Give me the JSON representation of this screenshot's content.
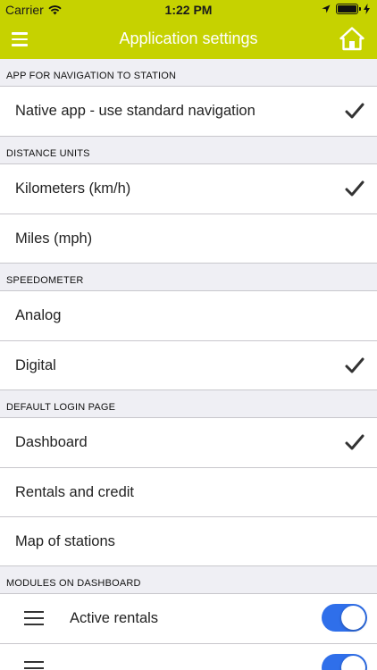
{
  "status_bar": {
    "carrier": "Carrier",
    "time": "1:22 PM",
    "battery_level": 1.0
  },
  "nav": {
    "title": "Application settings",
    "menu_icon": "hamburger-icon",
    "home_icon": "home-icon"
  },
  "colors": {
    "accent": "#c6d200",
    "toggle_on": "#2f6fea",
    "background": "#efeff4"
  },
  "sections": {
    "navigation": {
      "header": "APP FOR NAVIGATION TO STATION",
      "items": [
        {
          "label": "Native app - use standard navigation",
          "checked": true
        }
      ]
    },
    "distance": {
      "header": "DISTANCE UNITS",
      "items": [
        {
          "label": "Kilometers (km/h)",
          "checked": true
        },
        {
          "label": "Miles (mph)",
          "checked": false
        }
      ]
    },
    "speedometer": {
      "header": "SPEEDOMETER",
      "items": [
        {
          "label": "Analog",
          "checked": false
        },
        {
          "label": "Digital",
          "checked": true
        }
      ]
    },
    "login": {
      "header": "DEFAULT LOGIN PAGE",
      "items": [
        {
          "label": "Dashboard",
          "checked": true
        },
        {
          "label": "Rentals and credit",
          "checked": false
        },
        {
          "label": "Map of stations",
          "checked": false
        }
      ]
    },
    "modules": {
      "header": "MODULES ON DASHBOARD",
      "items": [
        {
          "label": "Active rentals",
          "enabled": true
        },
        {
          "label": "",
          "enabled": true
        }
      ]
    }
  }
}
